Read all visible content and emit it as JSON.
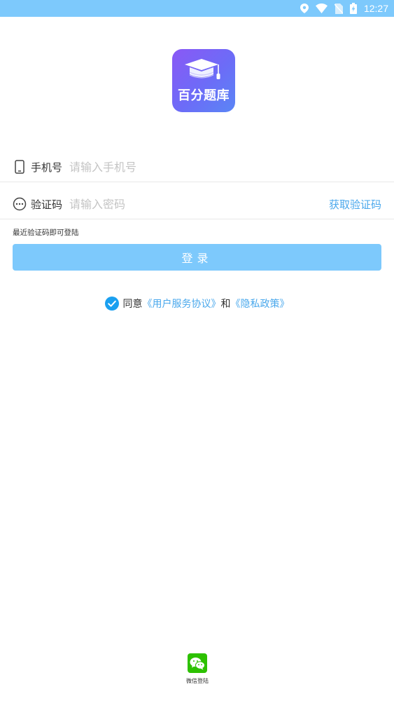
{
  "status_bar": {
    "time": "12:27",
    "icons": [
      "location-icon",
      "wifi-icon",
      "no-sim-icon",
      "battery-charging-icon"
    ]
  },
  "logo": {
    "text": "百分题库",
    "icon": "graduation-cap-icon"
  },
  "phone_field": {
    "label": "手机号",
    "placeholder": "请输入手机号",
    "value": "",
    "icon": "phone-icon"
  },
  "code_field": {
    "label": "验证码",
    "placeholder": "请输入密码",
    "value": "",
    "icon": "chat-bubble-icon",
    "get_code_label": "获取验证码"
  },
  "hint": "最近验证码即可登陆",
  "login_button": "登录",
  "agreement": {
    "checked": true,
    "prefix": "同意",
    "user_agreement": "《用户服务协议》",
    "conjunction": "和",
    "privacy_policy": "《隐私政策》"
  },
  "wechat_login": {
    "label": "微信登陆",
    "icon": "wechat-icon"
  },
  "colors": {
    "accent": "#7dc9fc",
    "link": "#4aa8ec",
    "check": "#1aa0f0",
    "wechat": "#2dc100",
    "logo_gradient_start": "#8a58f6",
    "logo_gradient_end": "#5a86f6"
  }
}
